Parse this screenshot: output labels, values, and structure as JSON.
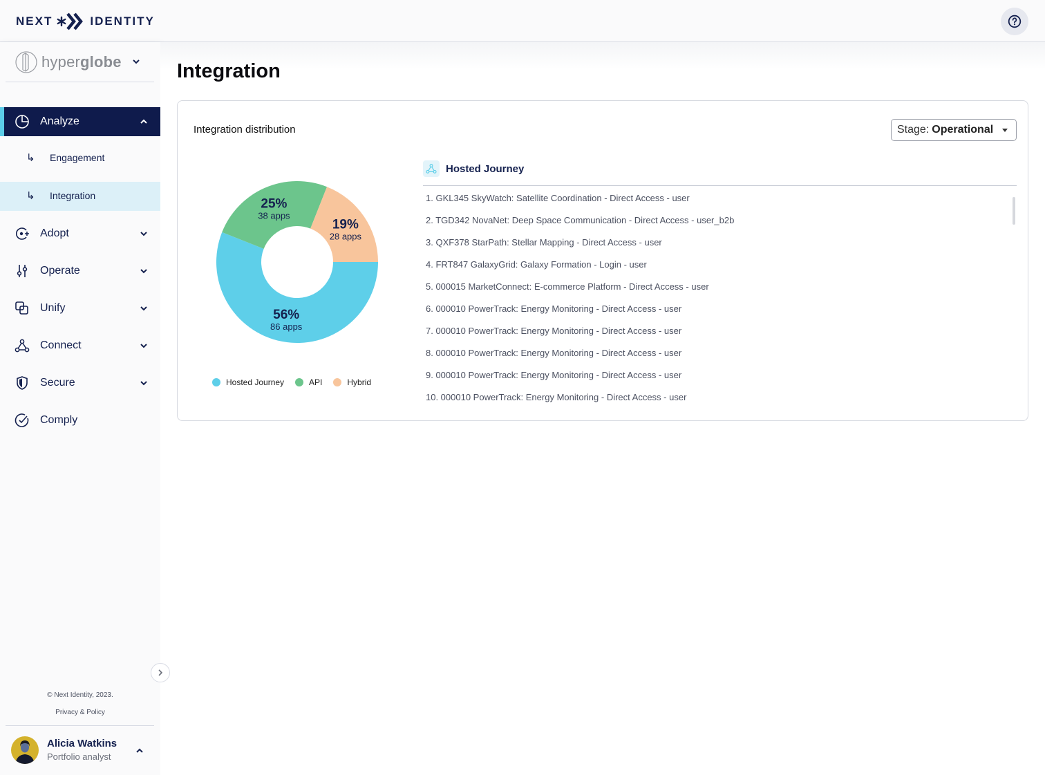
{
  "header": {
    "logo_left": "NEXT",
    "logo_right": "IDENTITY",
    "help_icon": "question-circle-icon"
  },
  "sidebar": {
    "workspace": {
      "name_light": "hyper",
      "name_bold": "globe"
    },
    "items": [
      {
        "label": "Analyze",
        "icon": "pie-chart-icon",
        "expanded": true,
        "children": [
          {
            "label": "Engagement"
          },
          {
            "label": "Integration",
            "selected": true
          }
        ]
      },
      {
        "label": "Adopt",
        "icon": "target-plus-icon"
      },
      {
        "label": "Operate",
        "icon": "sliders-icon"
      },
      {
        "label": "Unify",
        "icon": "overlap-squares-icon"
      },
      {
        "label": "Connect",
        "icon": "network-icon"
      },
      {
        "label": "Secure",
        "icon": "shield-icon"
      },
      {
        "label": "Comply",
        "icon": "check-circle-icon"
      }
    ],
    "copyright": "© Next Identity, 2023.",
    "privacy": "Privacy & Policy",
    "user": {
      "name": "Alicia Watkins",
      "role": "Portfolio analyst"
    }
  },
  "page": {
    "title": "Integration",
    "card": {
      "title": "Integration distribution",
      "stage_label": "Stage:",
      "stage_value": "Operational",
      "list_title": "Hosted Journey",
      "list": [
        "1. GKL345 SkyWatch: Satellite Coordination - Direct Access - user",
        "2. TGD342 NovaNet: Deep Space Communication - Direct Access - user_b2b",
        "3. QXF378 StarPath: Stellar Mapping - Direct Access - user",
        "4. FRT847 GalaxyGrid: Galaxy Formation - Login - user",
        "5. 000015 MarketConnect: E-commerce Platform - Direct Access - user",
        "6. 000010 PowerTrack: Energy Monitoring - Direct Access - user",
        "7. 000010 PowerTrack: Energy Monitoring - Direct Access - user",
        "8. 000010 PowerTrack: Energy Monitoring - Direct Access - user",
        "9. 000010 PowerTrack: Energy Monitoring - Direct Access - user",
        "10. 000010 PowerTrack: Energy Monitoring - Direct Access - user"
      ]
    }
  },
  "chart_data": {
    "type": "pie",
    "title": "Integration distribution",
    "categories": [
      "Hosted Journey",
      "API",
      "Hybrid"
    ],
    "values": [
      56,
      25,
      19
    ],
    "counts": [
      86,
      38,
      28
    ],
    "labels": [
      "56%",
      "25%",
      "19%"
    ],
    "sublabels": [
      "86 apps",
      "38 apps",
      "28 apps"
    ],
    "colors": [
      "#5ecfe9",
      "#6cc58c",
      "#f8c59c"
    ],
    "legend_position": "bottom",
    "donut": true
  }
}
